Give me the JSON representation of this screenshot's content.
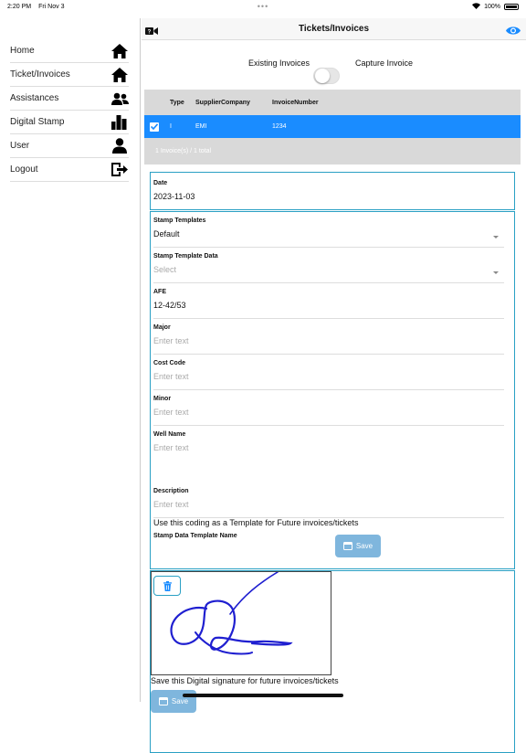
{
  "status": {
    "time": "2:20 PM",
    "date": "Fri Nov 3",
    "dots": "•••",
    "battery": "100%"
  },
  "header": {
    "title": "Tickets/Invoices"
  },
  "sidebar": {
    "items": [
      {
        "label": "Home",
        "icon": "home-icon"
      },
      {
        "label": "Ticket/Invoices",
        "icon": "home-icon"
      },
      {
        "label": "Assistances",
        "icon": "users-icon"
      },
      {
        "label": "Digital Stamp",
        "icon": "bar-chart-icon"
      },
      {
        "label": "User",
        "icon": "user-icon"
      },
      {
        "label": "Logout",
        "icon": "logout-icon"
      }
    ]
  },
  "toggle": {
    "left_label": "Existing Invoices",
    "right_label": "Capture Invoice",
    "on": false
  },
  "table": {
    "headers": [
      "Type",
      "SupplierCompany",
      "InvoiceNumber"
    ],
    "rows": [
      {
        "checked": true,
        "type": "I",
        "supplier": "EMI",
        "invoice": "1234"
      }
    ],
    "footer": "1 Invoice(s) / 1 total"
  },
  "form": {
    "date_label": "Date",
    "date_value": "2023-11-03",
    "stamp_templates_label": "Stamp Templates",
    "stamp_templates_value": "Default",
    "stamp_template_data_label": "Stamp Template Data",
    "stamp_template_data_placeholder": "Select",
    "afe_label": "AFE",
    "afe_value": "12-42/53",
    "major_label": "Major",
    "cost_code_label": "Cost Code",
    "minor_label": "Minor",
    "well_name_label": "Well Name",
    "description_label": "Description",
    "placeholder": "Enter text",
    "template_note": "Use this coding as a Template for Future invoices/tickets",
    "stamp_data_template_name_label": "Stamp Data Template Name",
    "save_label": "Save"
  },
  "signature": {
    "note": "Save this Digital signature for future invoices/tickets",
    "save_label": "Save"
  },
  "colors": {
    "accent": "#1a8cff",
    "border": "#2aa0c4",
    "save_button": "#7fb6dd"
  }
}
